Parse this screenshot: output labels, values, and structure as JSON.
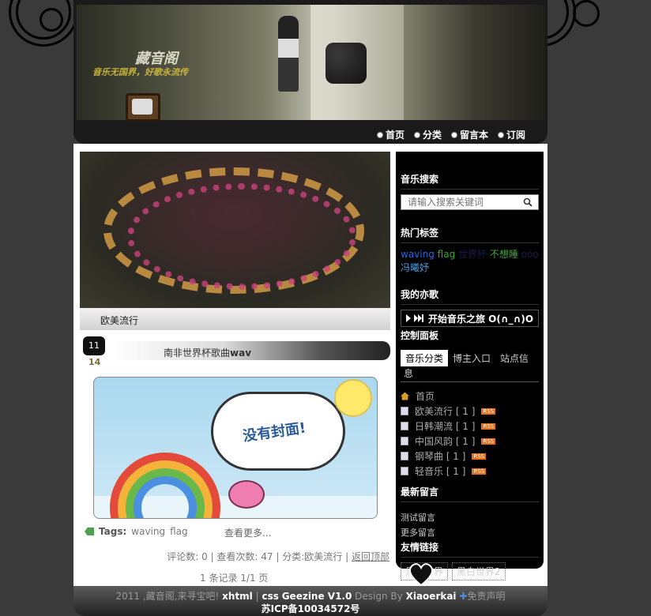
{
  "header": {
    "site_title": "藏音阁",
    "slogan": "音乐无国界，好歌永流传",
    "nav": [
      {
        "label": "首页"
      },
      {
        "label": "分类"
      },
      {
        "label": "留言本"
      },
      {
        "label": "订阅"
      }
    ]
  },
  "feature": {
    "caption": "欧美流行"
  },
  "post": {
    "date_day": "14",
    "title_prefix": "南非世界杯歌曲",
    "title_suffix": "wav",
    "cover_text": "没有封面!",
    "tags_label": "Tags:",
    "tags": [
      "waving",
      "flag"
    ],
    "read_more": "查看更多...",
    "meta": {
      "comments": "评论数: 0",
      "views": "查看次数: 47",
      "category": "分类:欧美流行",
      "back_top": "返回顶部"
    },
    "pager": "1 条记录 1/1 页"
  },
  "sidebar": {
    "search": {
      "title": "音乐搜索",
      "placeholder": "请输入搜索关键词"
    },
    "hot_tags": {
      "title": "热门标签",
      "tags": [
        {
          "label": "waving",
          "color": "#2a66d9"
        },
        {
          "label": "flag",
          "color": "#3aa53a"
        },
        {
          "label": "世界杯",
          "color": "#1b1b4a"
        },
        {
          "label": "不想睡",
          "color": "#3aa53a"
        },
        {
          "label": "ooo",
          "color": "#1b1b4a"
        },
        {
          "label": "冯曦妤",
          "color": "#4a9ad9"
        }
      ]
    },
    "my_songs": {
      "title": "我的亦歌",
      "player_label": "开始音乐之旅 O(∩_∩)O"
    },
    "control_panel": {
      "title": "控制面板",
      "tabs": [
        "音乐分类",
        "博主入口",
        "站点信"
      ],
      "tab_extra": "息",
      "items": [
        {
          "label": "首页",
          "rss": false,
          "icon": "home-icon"
        },
        {
          "label": "欧美流行 [ 1 ]",
          "rss": true,
          "icon": "page-icon"
        },
        {
          "label": "日韩潮流 [ 1 ]",
          "rss": true,
          "icon": "page-icon"
        },
        {
          "label": "中国风韵 [ 1 ]",
          "rss": true,
          "icon": "page-icon"
        },
        {
          "label": "钢琴曲 [ 1 ]",
          "rss": true,
          "icon": "page-icon"
        },
        {
          "label": "轻音乐 [ 1 ]",
          "rss": true,
          "icon": "page-icon"
        }
      ],
      "rss_label": "RSS"
    },
    "latest_comments": {
      "title": "最新留言",
      "items": [
        "测试留言",
        "更多留言"
      ]
    },
    "friend_links": {
      "title": "友情链接",
      "items": [
        "黑白世界",
        "黑白世界2"
      ]
    }
  },
  "footer": {
    "line1_prefix": "2011 ,藏音阁,来寻宝吧!",
    "xhtml": "xhtml",
    "css": "css",
    "theme": "Geezine V1.0",
    "design_by": "Design By",
    "author": "Xiaoerkai",
    "disclaimer": "免责声明",
    "icp": "苏ICP备10034572号"
  },
  "colors": {
    "page_bg": "#3a3a3a",
    "sidebar_bg": "#000000",
    "rss": "#e66f1a"
  }
}
